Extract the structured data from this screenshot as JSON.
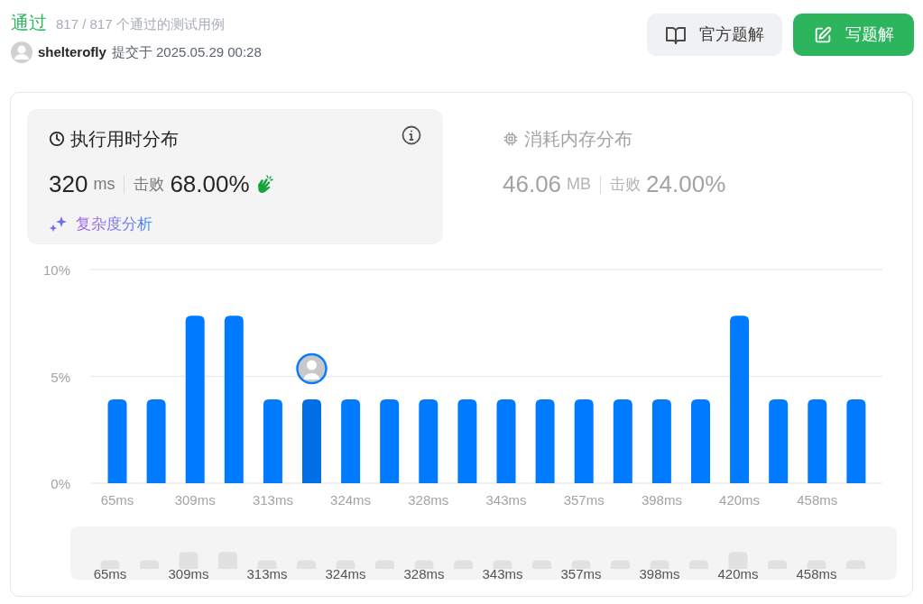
{
  "result": {
    "status": "通过",
    "cases": "817 / 817 个通过的测试用例"
  },
  "submission": {
    "user": "shelterofly",
    "submitted_at": "提交于 2025.05.29 00:28"
  },
  "buttons": [
    {
      "kind": "secondary",
      "label": "官方题解"
    },
    {
      "kind": "primary",
      "label": "写题解"
    }
  ],
  "stat_tabs": [
    {
      "kind": "runtime",
      "selected": true,
      "title": "执行用时分布",
      "value": "320",
      "unit": "ms",
      "beats_label": "击败",
      "beats": "68.00%",
      "link": "复杂度分析"
    },
    {
      "kind": "memory",
      "selected": false,
      "title": "消耗内存分布",
      "value": "46.06",
      "unit": "MB",
      "beats_label": "击败",
      "beats": "24.00%"
    }
  ],
  "chart_data": {
    "type": "bar",
    "yticks": [
      {
        "value": 0,
        "label": "0%"
      },
      {
        "value": 5,
        "label": "5%"
      },
      {
        "value": 10,
        "label": "10%"
      }
    ],
    "ylim": [
      0,
      10
    ],
    "categories": [
      "65ms",
      null,
      "309ms",
      null,
      "313ms",
      null,
      "324ms",
      null,
      "328ms",
      null,
      "343ms",
      null,
      "357ms",
      null,
      "398ms",
      null,
      "420ms",
      null,
      "458ms",
      null
    ],
    "stacked": true,
    "series": [
      {
        "color": "#007aff",
        "values": [
          3.92,
          3.92,
          7.84,
          7.84,
          3.92,
          null,
          3.92,
          3.92,
          3.92,
          3.92,
          3.92,
          3.92,
          3.92,
          3.92,
          3.92,
          3.92,
          7.84,
          3.92,
          3.92,
          3.92
        ]
      },
      {
        "color": "#006fe6",
        "values": [
          null,
          null,
          null,
          null,
          null,
          3.92,
          null,
          null,
          null,
          null,
          null,
          null,
          null,
          null,
          null,
          null,
          null,
          null,
          null,
          null
        ]
      }
    ]
  },
  "overview_labels": [
    "65ms",
    "309ms",
    "313ms",
    "324ms",
    "328ms",
    "343ms",
    "357ms",
    "398ms",
    "420ms",
    "458ms"
  ]
}
